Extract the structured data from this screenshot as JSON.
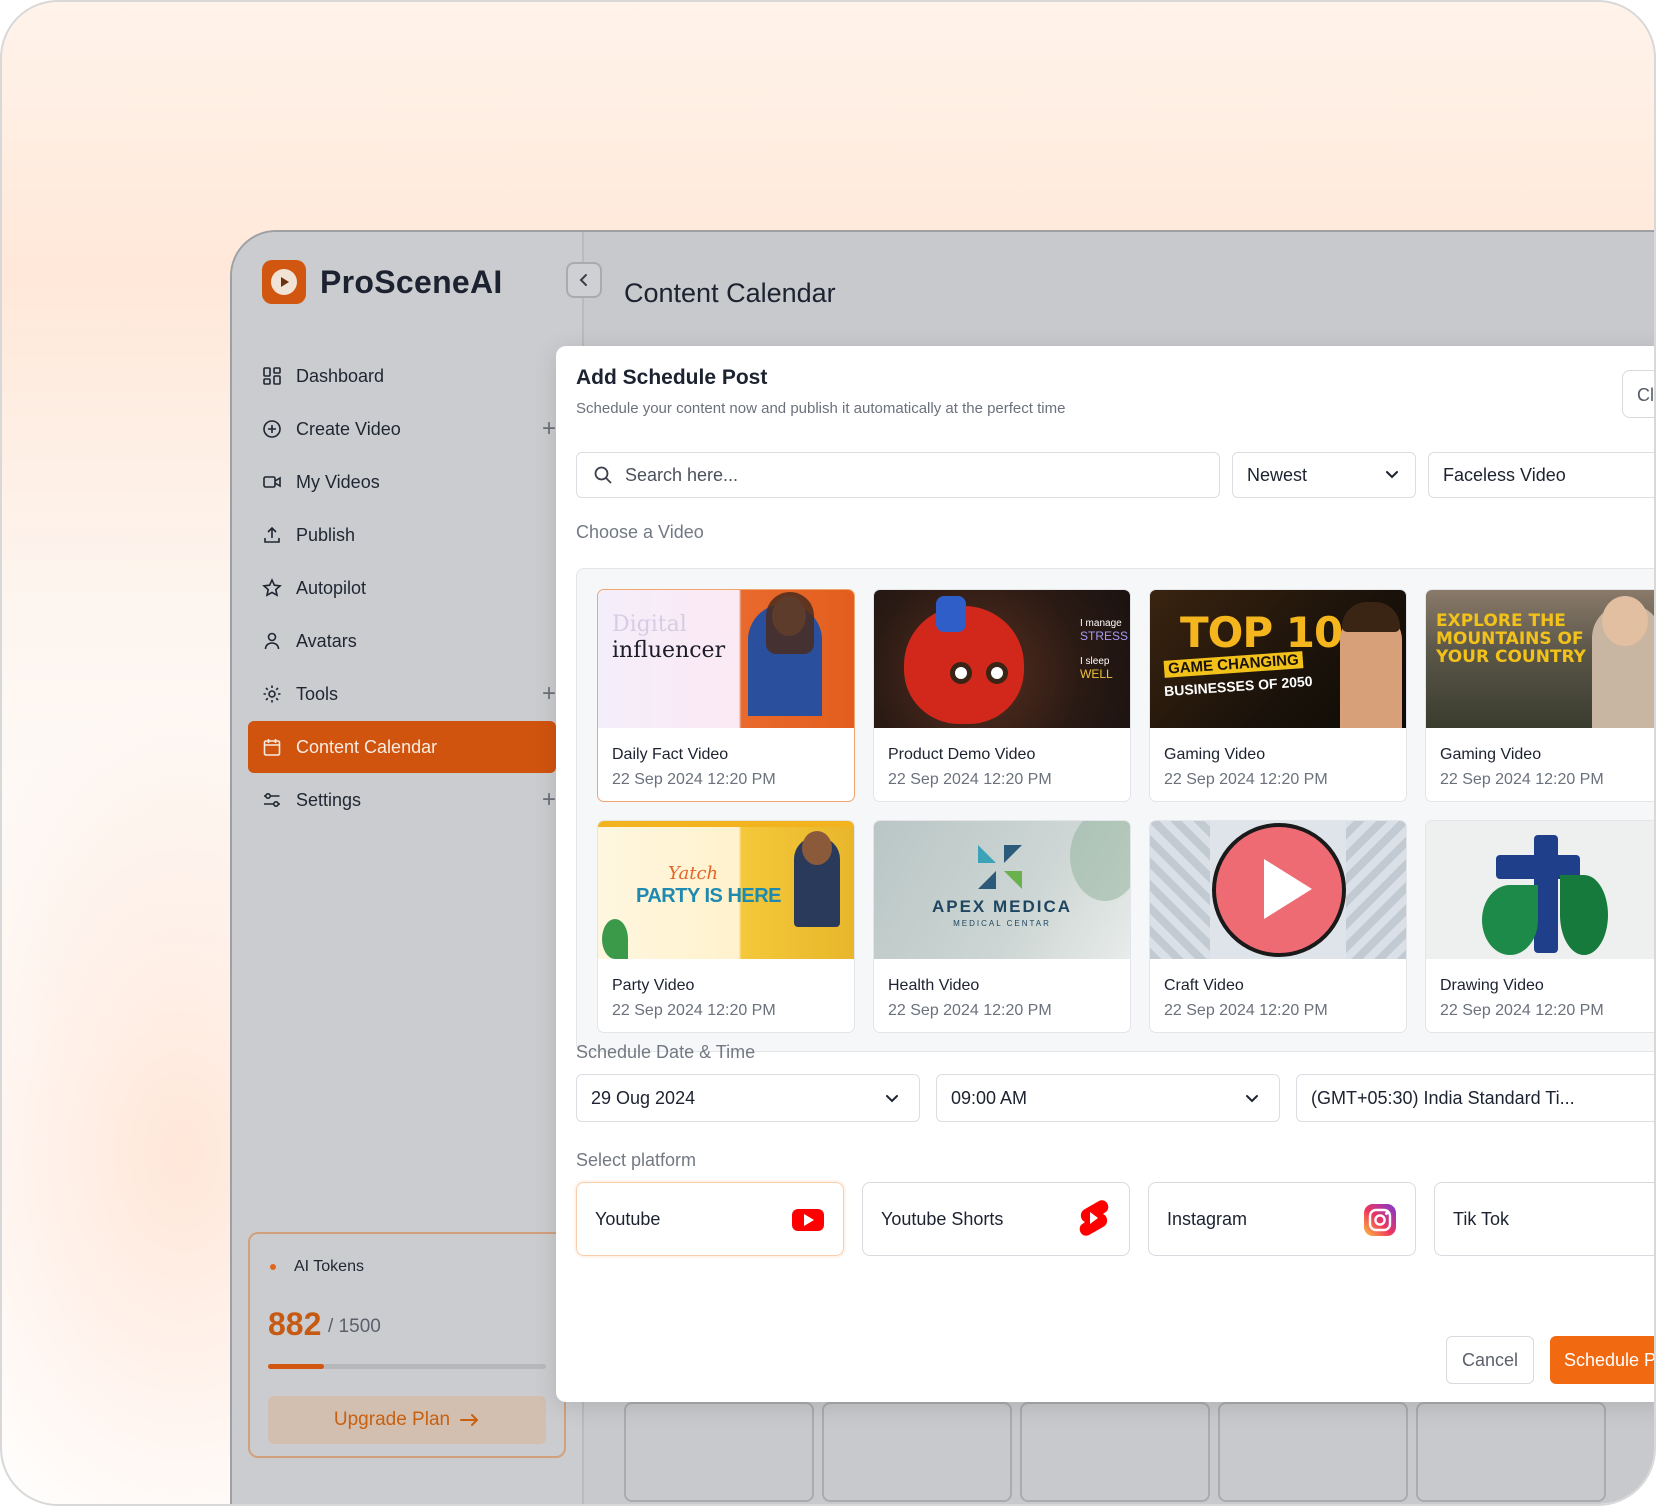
{
  "app": {
    "brand": "ProSceneAI",
    "page_title": "Content Calendar"
  },
  "sidebar": {
    "items": [
      {
        "label": "Dashboard",
        "icon": "dashboard-icon",
        "expandable": false,
        "active": false
      },
      {
        "label": "Create Video",
        "icon": "plus-circle-icon",
        "expandable": true,
        "active": false
      },
      {
        "label": "My Videos",
        "icon": "video-camera-icon",
        "expandable": false,
        "active": false
      },
      {
        "label": "Publish",
        "icon": "upload-icon",
        "expandable": false,
        "active": false
      },
      {
        "label": "Autopilot",
        "icon": "star-icon",
        "expandable": false,
        "active": false
      },
      {
        "label": "Avatars",
        "icon": "user-icon",
        "expandable": false,
        "active": false
      },
      {
        "label": "Tools",
        "icon": "gear-icon",
        "expandable": true,
        "active": false
      },
      {
        "label": "Content Calendar",
        "icon": "calendar-icon",
        "expandable": false,
        "active": true
      },
      {
        "label": "Settings",
        "icon": "sliders-icon",
        "expandable": true,
        "active": false
      }
    ],
    "tokens": {
      "title": "AI Tokens",
      "used": "882",
      "max": "/ 1500",
      "progress_fraction": 0.2,
      "upgrade_label": "Upgrade Plan"
    }
  },
  "modal": {
    "title": "Add Schedule Post",
    "subtitle": "Schedule your content now and publish it automatically at the perfect time",
    "close_label": "Cl",
    "search_placeholder": "Search here...",
    "sort_value": "Newest",
    "type_value": "Faceless Video",
    "choose_label": "Choose a Video",
    "videos": [
      {
        "name": "Daily Fact Video",
        "date": "22 Sep 2024 12:20 PM",
        "selected": true
      },
      {
        "name": "Product Demo Video",
        "date": "22 Sep 2024 12:20 PM",
        "selected": false
      },
      {
        "name": "Gaming Video",
        "date": "22 Sep 2024 12:20 PM",
        "selected": false
      },
      {
        "name": "Gaming Video",
        "date": "22 Sep 2024 12:20 PM",
        "selected": false
      },
      {
        "name": "Party Video",
        "date": "22 Sep 2024 12:20 PM",
        "selected": false
      },
      {
        "name": "Health Video",
        "date": "22 Sep 2024 12:20 PM",
        "selected": false
      },
      {
        "name": "Craft Video",
        "date": "22 Sep 2024 12:20 PM",
        "selected": false
      },
      {
        "name": "Drawing Video",
        "date": "22 Sep 2024 12:20 PM",
        "selected": false
      }
    ],
    "thumb_text": {
      "influencer_1": "Digital",
      "influencer_2": "influencer",
      "top10_1": "TOP 10",
      "top10_2": "GAME CHANGING",
      "top10_3": "BUSINESSES OF 2050",
      "mountains_1": "EXPLORE THE",
      "mountains_2": "MOUNTAINS OF",
      "mountains_3": "YOUR COUNTRY",
      "party_1": "Yatch",
      "party_2": "PARTY IS HERE",
      "apex_1": "APEX MEDICA",
      "apex_2": "MEDICAL CENTAR",
      "heart_1": "I manage",
      "heart_2": "STRESS",
      "heart_3": "I sleep",
      "heart_4": "WELL"
    },
    "schedule_label": "Schedule Date & Time",
    "date_value": "29 Oug 2024",
    "time_value": "09:00 AM",
    "timezone_value": "(GMT+05:30) India Standard Ti...",
    "platform_label": "Select platform",
    "platforms": [
      {
        "label": "Youtube",
        "icon": "youtube-icon",
        "selected": true
      },
      {
        "label": "Youtube Shorts",
        "icon": "youtube-shorts-icon",
        "selected": false
      },
      {
        "label": "Instagram",
        "icon": "instagram-icon",
        "selected": false
      },
      {
        "label": "Tik Tok",
        "icon": "tiktok-icon",
        "selected": false
      }
    ],
    "cancel_label": "Cancel",
    "schedule_button_label": "Schedule Post"
  },
  "colors": {
    "accent": "#F16A12",
    "brand": "#D1560F",
    "youtube": "#FF0000"
  }
}
